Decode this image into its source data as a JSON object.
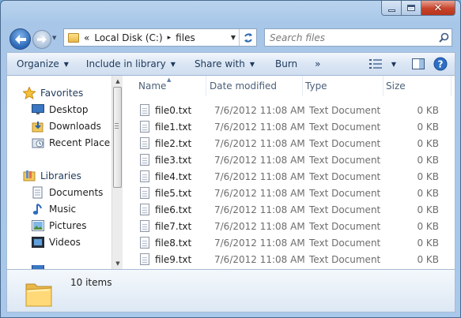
{
  "window": {
    "caption_buttons": {
      "close_glyph": "✕"
    }
  },
  "address": {
    "overflow": "«",
    "crumbs": [
      "Local Disk (C:)",
      "files"
    ],
    "separator": "▸"
  },
  "search": {
    "placeholder": "Search files"
  },
  "toolbar": {
    "organize": "Organize",
    "include_in_library": "Include in library",
    "share_with": "Share with",
    "burn": "Burn",
    "more": "»"
  },
  "nav": {
    "favorites": {
      "label": "Favorites",
      "icon": "star-icon"
    },
    "favorites_items": [
      {
        "label": "Desktop",
        "icon": "desktop-icon"
      },
      {
        "label": "Downloads",
        "icon": "downloads-icon"
      },
      {
        "label": "Recent Places",
        "icon": "recent-places-icon"
      }
    ],
    "libraries": {
      "label": "Libraries",
      "icon": "libraries-icon"
    },
    "libraries_items": [
      {
        "label": "Documents",
        "icon": "documents-icon"
      },
      {
        "label": "Music",
        "icon": "music-icon"
      },
      {
        "label": "Pictures",
        "icon": "pictures-icon"
      },
      {
        "label": "Videos",
        "icon": "videos-icon"
      }
    ]
  },
  "columns": {
    "name": "Name",
    "date": "Date modified",
    "type": "Type",
    "size": "Size"
  },
  "files": [
    {
      "name": "file0.txt",
      "date": "7/6/2012 11:08 AM",
      "type": "Text Document",
      "size": "0 KB"
    },
    {
      "name": "file1.txt",
      "date": "7/6/2012 11:08 AM",
      "type": "Text Document",
      "size": "0 KB"
    },
    {
      "name": "file2.txt",
      "date": "7/6/2012 11:08 AM",
      "type": "Text Document",
      "size": "0 KB"
    },
    {
      "name": "file3.txt",
      "date": "7/6/2012 11:08 AM",
      "type": "Text Document",
      "size": "0 KB"
    },
    {
      "name": "file4.txt",
      "date": "7/6/2012 11:08 AM",
      "type": "Text Document",
      "size": "0 KB"
    },
    {
      "name": "file5.txt",
      "date": "7/6/2012 11:08 AM",
      "type": "Text Document",
      "size": "0 KB"
    },
    {
      "name": "file6.txt",
      "date": "7/6/2012 11:08 AM",
      "type": "Text Document",
      "size": "0 KB"
    },
    {
      "name": "file7.txt",
      "date": "7/6/2012 11:08 AM",
      "type": "Text Document",
      "size": "0 KB"
    },
    {
      "name": "file8.txt",
      "date": "7/6/2012 11:08 AM",
      "type": "Text Document",
      "size": "0 KB"
    },
    {
      "name": "file9.txt",
      "date": "7/6/2012 11:08 AM",
      "type": "Text Document",
      "size": "0 KB"
    }
  ],
  "status": {
    "item_count": "10 items"
  },
  "colors": {
    "accent": "#1e395b",
    "close": "#c7432a",
    "window_frame": "#a9c8ea"
  }
}
